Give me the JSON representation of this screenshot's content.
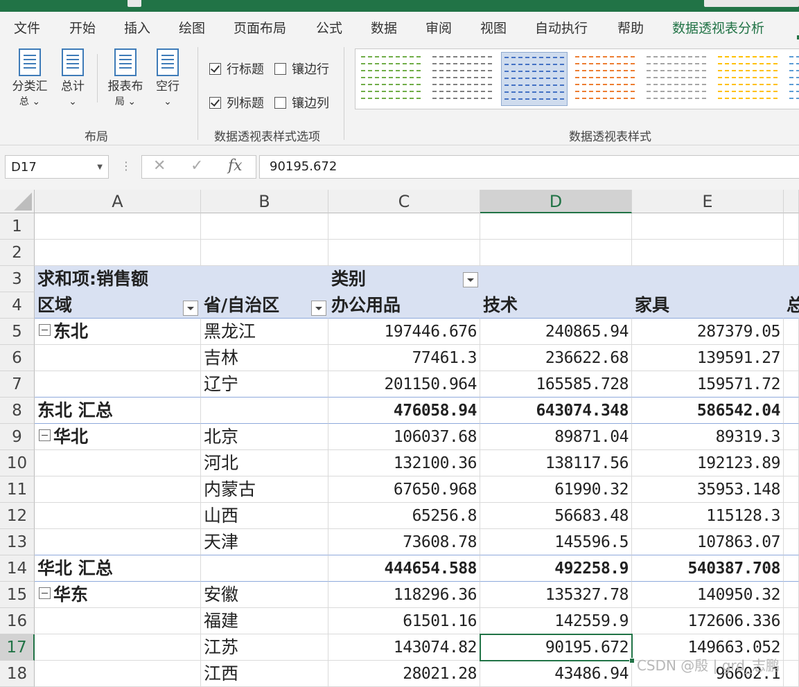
{
  "ribbon_tabs": [
    "文件",
    "开始",
    "插入",
    "绘图",
    "页面布局",
    "公式",
    "数据",
    "审阅",
    "视图",
    "自动执行",
    "帮助",
    "数据透视表分析"
  ],
  "layout_group": {
    "label": "布局",
    "buttons": [
      {
        "line1": "分类汇",
        "line2": "总 ⌄"
      },
      {
        "line1": "总计",
        "line2": "⌄"
      },
      {
        "line1": "报表布",
        "line2": "局 ⌄"
      },
      {
        "line1": "空行",
        "line2": "⌄"
      }
    ]
  },
  "style_options_group": {
    "label": "数据透视表样式选项",
    "row_headers": {
      "label": "行标题",
      "checked": true
    },
    "banded_rows": {
      "label": "镶边行",
      "checked": false
    },
    "col_headers": {
      "label": "列标题",
      "checked": true
    },
    "banded_cols": {
      "label": "镶边列",
      "checked": false
    }
  },
  "styles_group": {
    "label": "数据透视表样式",
    "swatch_colors": [
      "#70ad47",
      "#7f7f7f",
      "#4472c4",
      "#ed7d31",
      "#a5a5a5",
      "#ffc000",
      "#5b9bd5"
    ]
  },
  "formula_bar": {
    "name_box": "D17",
    "cancel_icon": "✕",
    "enter_icon": "✓",
    "fx_label": "fx",
    "value": "90195.672"
  },
  "columns": [
    "A",
    "B",
    "C",
    "D",
    "E"
  ],
  "rows": [
    "1",
    "2",
    "3",
    "4",
    "5",
    "6",
    "7",
    "8",
    "9",
    "10",
    "11",
    "12",
    "13",
    "14",
    "15",
    "16",
    "17",
    "18"
  ],
  "pivot": {
    "value_field": "求和项:销售额",
    "column_field": "类别",
    "row_field_a": "区域",
    "row_field_b": "省/自治区",
    "categories": [
      "办公用品",
      "技术",
      "家具",
      "总"
    ],
    "body": [
      {
        "a": "东北",
        "expand": true,
        "b": "黑龙江",
        "c": "197446.676",
        "d": "240865.94",
        "e": "287379.05"
      },
      {
        "a": "",
        "b": "吉林",
        "c": "77461.3",
        "d": "236622.68",
        "e": "139591.27"
      },
      {
        "a": "",
        "b": "辽宁",
        "c": "201150.964",
        "d": "165585.728",
        "e": "159571.72"
      },
      {
        "a": "东北 汇总",
        "total": true,
        "b": "",
        "c": "476058.94",
        "d": "643074.348",
        "e": "586542.04"
      },
      {
        "a": "华北",
        "expand": true,
        "b": "北京",
        "c": "106037.68",
        "d": "89871.04",
        "e": "89319.3"
      },
      {
        "a": "",
        "b": "河北",
        "c": "132100.36",
        "d": "138117.56",
        "e": "192123.89"
      },
      {
        "a": "",
        "b": "内蒙古",
        "c": "67650.968",
        "d": "61990.32",
        "e": "35953.148"
      },
      {
        "a": "",
        "b": "山西",
        "c": "65256.8",
        "d": "56683.48",
        "e": "115128.3"
      },
      {
        "a": "",
        "b": "天津",
        "c": "73608.78",
        "d": "145596.5",
        "e": "107863.07"
      },
      {
        "a": "华北 汇总",
        "total": true,
        "b": "",
        "c": "444654.588",
        "d": "492258.9",
        "e": "540387.708"
      },
      {
        "a": "华东",
        "expand": true,
        "b": "安徽",
        "c": "118296.36",
        "d": "135327.78",
        "e": "140950.32"
      },
      {
        "a": "",
        "b": "福建",
        "c": "61501.16",
        "d": "142559.9",
        "e": "172606.336"
      },
      {
        "a": "",
        "b": "江苏",
        "c": "143074.82",
        "d": "90195.672",
        "e": "149663.052"
      },
      {
        "a": "",
        "b": "江西",
        "c": "28021.28",
        "d": "43486.94",
        "e": "96602.1"
      }
    ]
  },
  "watermark": "CSDN @殷 | grd_志鹏"
}
